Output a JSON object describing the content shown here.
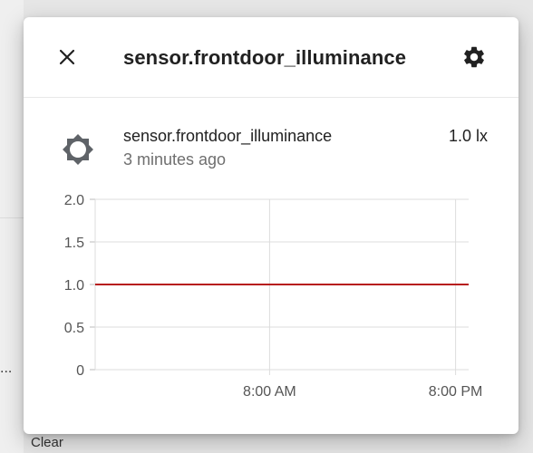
{
  "background": {
    "left_fragment_1": "...",
    "left_fragment_2": "Clear"
  },
  "dialog": {
    "title": "sensor.frontdoor_illuminance",
    "close_icon": "close-icon",
    "settings_icon": "gear-icon"
  },
  "entity": {
    "icon": "brightness-icon",
    "name": "sensor.frontdoor_illuminance",
    "last_changed": "3 minutes ago",
    "state": "1.0 lx"
  },
  "colors": {
    "line": "#b71c1c",
    "grid": "#dddddd"
  },
  "chart_data": {
    "type": "line",
    "y_ticks": [
      "2.0",
      "1.5",
      "1.0",
      "0.5",
      "0"
    ],
    "x_ticks": [
      "8:00 AM",
      "8:00 PM"
    ],
    "ylim": [
      0,
      2.0
    ],
    "series": [
      {
        "x": [
          0,
          1
        ],
        "y": [
          1.0,
          1.0
        ]
      }
    ]
  }
}
